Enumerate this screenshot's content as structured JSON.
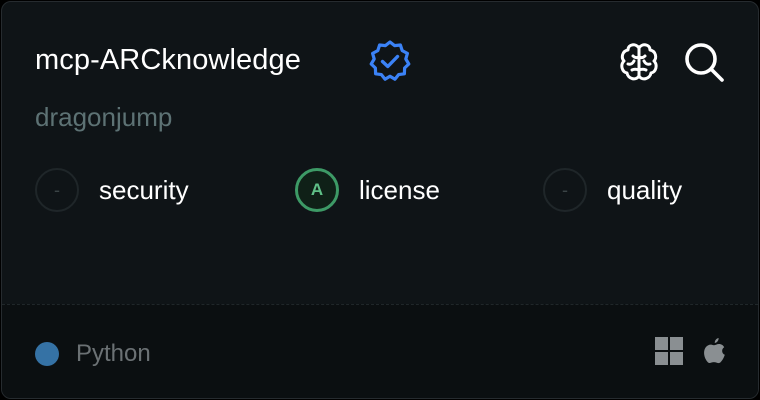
{
  "card": {
    "title": "mcp-ARCknowledge",
    "owner": "dragonjump",
    "title_icon": "verified-badge-icon",
    "actions": [
      "brain-icon",
      "search-icon"
    ]
  },
  "scores": [
    {
      "grade": "-",
      "label": "security",
      "status": "none"
    },
    {
      "grade": "A",
      "label": "license",
      "status": "good"
    },
    {
      "grade": "-",
      "label": "quality",
      "status": "none"
    }
  ],
  "footer": {
    "language": "Python",
    "language_color": "#3572a5",
    "platforms": [
      "windows-icon",
      "apple-icon"
    ]
  },
  "colors": {
    "background": "#0f1417",
    "accent_verified": "#3b82f6",
    "grade_good": "#3d9a66",
    "owner_text": "#5d7274"
  }
}
